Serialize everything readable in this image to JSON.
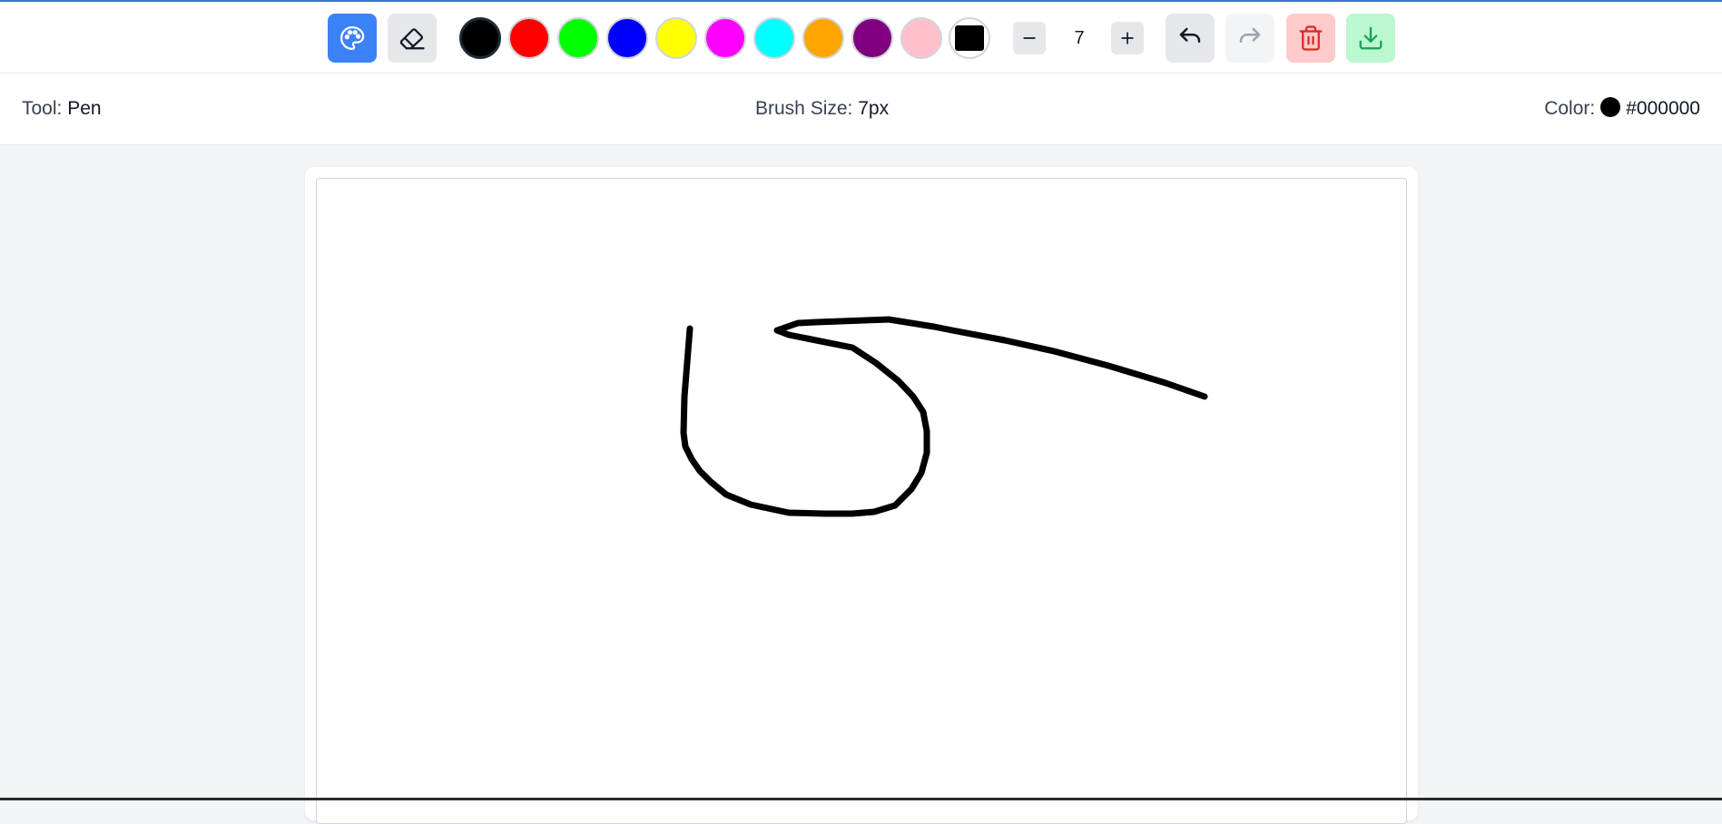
{
  "toolbar": {
    "tools": [
      {
        "name": "palette-icon",
        "active": true
      },
      {
        "name": "eraser-icon",
        "active": false
      }
    ],
    "colors": [
      "#000000",
      "#ff0000",
      "#00ff00",
      "#0000ff",
      "#ffff00",
      "#ff00ff",
      "#00ffff",
      "#ffa500",
      "#800080",
      "#ffc0cb"
    ],
    "selected_color": "#000000",
    "custom_color": "#000000",
    "brush_size": "7",
    "actions": [
      "undo-icon",
      "redo-icon",
      "trash-icon",
      "download-icon"
    ]
  },
  "status": {
    "tool_label": "Tool:",
    "tool_value": "Pen",
    "brush_label": "Brush Size:",
    "brush_value": "7px",
    "color_label": "Color:",
    "color_value": "#000000"
  }
}
